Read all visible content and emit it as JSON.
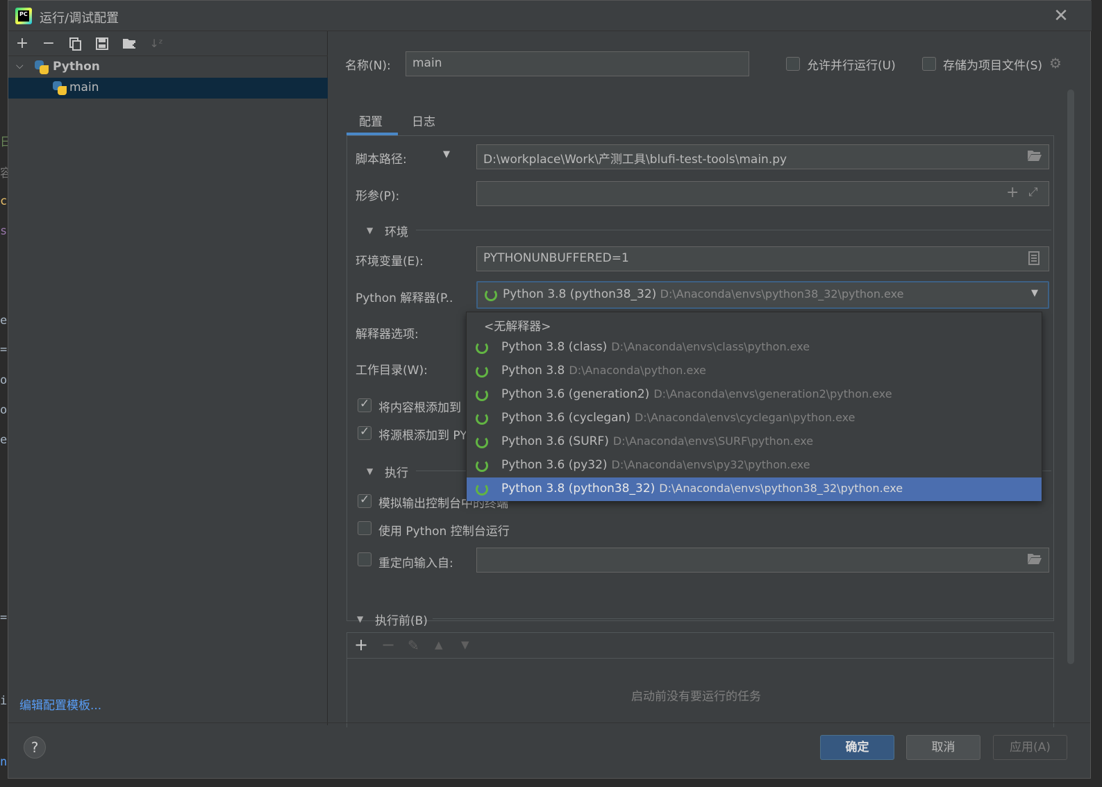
{
  "window": {
    "title": "运行/调试配置",
    "close_glyph": "✕"
  },
  "background_editor": [
    "日",
    "容",
    "c",
    "s",
    "e",
    "=",
    "o",
    "o",
    "e",
    "=",
    "i",
    "n"
  ],
  "left_toolbar": {
    "icons": [
      "add-icon",
      "remove-icon",
      "copy-icon",
      "save-icon",
      "folder-add-icon",
      "sort-icon"
    ]
  },
  "tree": {
    "root_label": "Python",
    "child_label": "main"
  },
  "left_footer": {
    "edit_templates_label": "编辑配置模板..."
  },
  "header": {
    "name_label": "名称(N):",
    "name_value": "main",
    "allow_parallel_label": "允许并行运行(U)",
    "store_as_project_label": "存储为项目文件(S)",
    "allow_parallel_checked": false,
    "store_as_project_checked": false
  },
  "tabs": [
    {
      "label": "配置",
      "active": true
    },
    {
      "label": "日志",
      "active": false
    }
  ],
  "config": {
    "script_path_label": "脚本路径:",
    "script_path_value": "D:\\workplace\\Work\\产测工具\\blufi-test-tools\\main.py",
    "params_label": "形参(P):",
    "params_value": "",
    "env_section_label": "环境",
    "env_vars_label": "环境变量(E):",
    "env_vars_value": "PYTHONUNBUFFERED=1",
    "interpreter_label": "Python 解释器(P..",
    "interpreter_name": "Python 3.8 (python38_32)",
    "interpreter_path": "D:\\Anaconda\\envs\\python38_32\\python.exe",
    "interp_options_label": "解释器选项:",
    "workdir_label": "工作目录(W):",
    "add_content_roots_label": "将内容根添加到",
    "add_source_roots_label": "将源根添加到 PY",
    "add_content_roots_checked": true,
    "add_source_roots_checked": true,
    "exec_section_label": "执行",
    "emulate_terminal_label": "模拟输出控制台中的终端",
    "emulate_terminal_checked": true,
    "use_python_console_label": "使用 Python 控制台运行",
    "use_python_console_checked": false,
    "redirect_input_label": "重定向输入自:",
    "redirect_input_checked": false
  },
  "interpreter_popup": {
    "items": [
      {
        "name": "<无解释器>",
        "path": "",
        "has_icon": false,
        "selected": false
      },
      {
        "name": "Python 3.8 (class)",
        "path": "D:\\Anaconda\\envs\\class\\python.exe",
        "has_icon": true,
        "selected": false
      },
      {
        "name": "Python 3.8",
        "path": "D:\\Anaconda\\python.exe",
        "has_icon": true,
        "selected": false
      },
      {
        "name": "Python 3.6 (generation2)",
        "path": "D:\\Anaconda\\envs\\generation2\\python.exe",
        "has_icon": true,
        "selected": false
      },
      {
        "name": "Python 3.6 (cyclegan)",
        "path": "D:\\Anaconda\\envs\\cyclegan\\python.exe",
        "has_icon": true,
        "selected": false
      },
      {
        "name": "Python 3.6 (SURF)",
        "path": "D:\\Anaconda\\envs\\SURF\\python.exe",
        "has_icon": true,
        "selected": false
      },
      {
        "name": "Python 3.6 (py32)",
        "path": "D:\\Anaconda\\envs\\py32\\python.exe",
        "has_icon": true,
        "selected": false
      },
      {
        "name": "Python 3.8 (python38_32)",
        "path": "D:\\Anaconda\\envs\\python38_32\\python.exe",
        "has_icon": true,
        "selected": true
      }
    ]
  },
  "before_launch": {
    "section_label": "执行前(B)",
    "empty_message": "启动前没有要运行的任务"
  },
  "buttons": {
    "ok_label": "确定",
    "cancel_label": "取消",
    "apply_label": "应用(A)",
    "help_label": "?"
  },
  "colors": {
    "accent": "#4a88c7",
    "selection": "#4b6eaf",
    "link": "#589df6",
    "python_green": "#62b543"
  }
}
